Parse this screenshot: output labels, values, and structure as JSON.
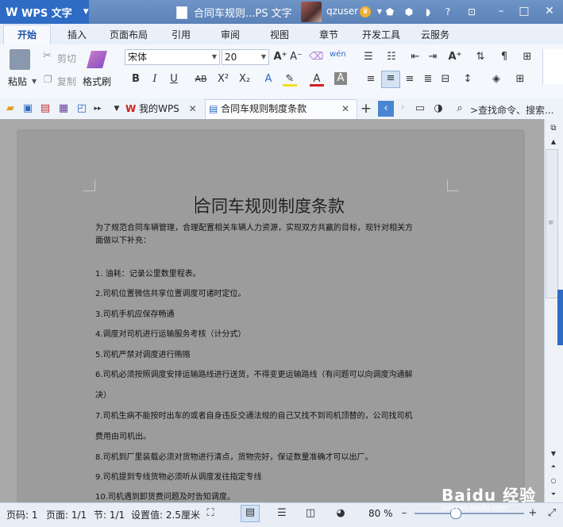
{
  "titlebar": {
    "app_button": "WPS 文字",
    "doc_title": "合同车规则...PS 文字",
    "username": "qzuser"
  },
  "menu": [
    "开始",
    "插入",
    "页面布局",
    "引用",
    "审阅",
    "视图",
    "章节",
    "开发工具",
    "云服务"
  ],
  "ribbon": {
    "paste": "粘贴",
    "cut": "剪切",
    "copy": "复制",
    "format_painter": "格式刷",
    "font_name": "宋体",
    "font_size": "20"
  },
  "quick_access": {
    "tabs": [
      "我的WPS",
      "合同车规则制度条款"
    ],
    "search_placeholder": ">查找命令、搜索..."
  },
  "document": {
    "title": "合同车规则制度条款",
    "lines": [
      "为了规范合同车辆管理，合理配置相关车辆人力资源，实现双方共赢的目标，现针对相关方",
      "面做以下补充：",
      "1.  油耗：记录公里数里程表。",
      "2.司机位置微信共享位置调度可诸时定位。",
      "3.司机手机应保存畅通",
      "4.调度对司机进行运输服务考核（计分式）",
      "5.司机严禁对调度进行贿赂",
      "6.司机必须按照调度安排运输路线进行送货，不得变更运输路线（有问题可以向调度沟通解",
      "决）",
      "7.司机生病不能按时出车的或者自身违反交通法规的自己又找不到司机顶替的，公司找司机",
      "费用由司机出。",
      "8.司机到厂里装载必须对货物进行清点，货物完好，保证数量准确才可以出厂。",
      "9.司机提到专线货物必须听从调度发往指定专线",
      "10.司机遇到卸货费问题及时告知调度。"
    ]
  },
  "status": {
    "page_num": "页码: 1",
    "pages": "页面: 1/1",
    "section": "节: 1/1",
    "settings": "设置值: 2.5厘米",
    "zoom": "80 %",
    "watermark": "jingyan.baidu.com"
  },
  "colors": {
    "accent": "#2d6bc4",
    "titlebar": "#5b82b8"
  }
}
